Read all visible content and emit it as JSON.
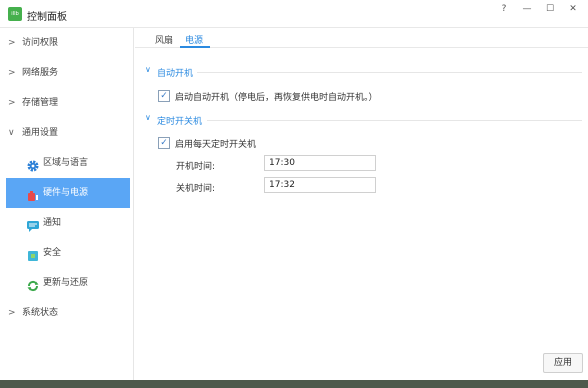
{
  "titlebar": {
    "title": "控制面板",
    "logo_text": "iIIb",
    "help": "?",
    "minimize": "—",
    "maximize": "☐",
    "close": "✕"
  },
  "sidebar": {
    "items": [
      {
        "label": "访问权限",
        "chevron": ">"
      },
      {
        "label": "网络服务",
        "chevron": ">"
      },
      {
        "label": "存储管理",
        "chevron": ">"
      },
      {
        "label": "通用设置",
        "chevron": "∨"
      },
      {
        "label": "系统状态",
        "chevron": ">"
      }
    ],
    "subitems": [
      {
        "label": "区域与语言",
        "icon": "gear-icon"
      },
      {
        "label": "硬件与电源",
        "icon": "hardware-power-icon",
        "active": true
      },
      {
        "label": "通知",
        "icon": "chat-icon"
      },
      {
        "label": "安全",
        "icon": "shield-icon"
      },
      {
        "label": "更新与还原",
        "icon": "refresh-icon"
      }
    ]
  },
  "tabs": [
    {
      "label": "风扇"
    },
    {
      "label": "电源",
      "active": true
    }
  ],
  "sections": {
    "auto_boot": {
      "title": "自动开机",
      "checkbox_label": "启动自动开机（停电后，再恢复供电时自动开机。）",
      "checked": true
    },
    "scheduled": {
      "title": "定时开关机",
      "checkbox_label": "启用每天定时开关机",
      "checked": true,
      "on_label": "开机时间:",
      "on_value": "17:30",
      "off_label": "关机时间:",
      "off_value": "17:32"
    }
  },
  "footer": {
    "apply_label": "应用"
  },
  "colors": {
    "accent": "#2b8ae0",
    "active_bg": "#5aa6f5",
    "logo": "#45b04d"
  }
}
